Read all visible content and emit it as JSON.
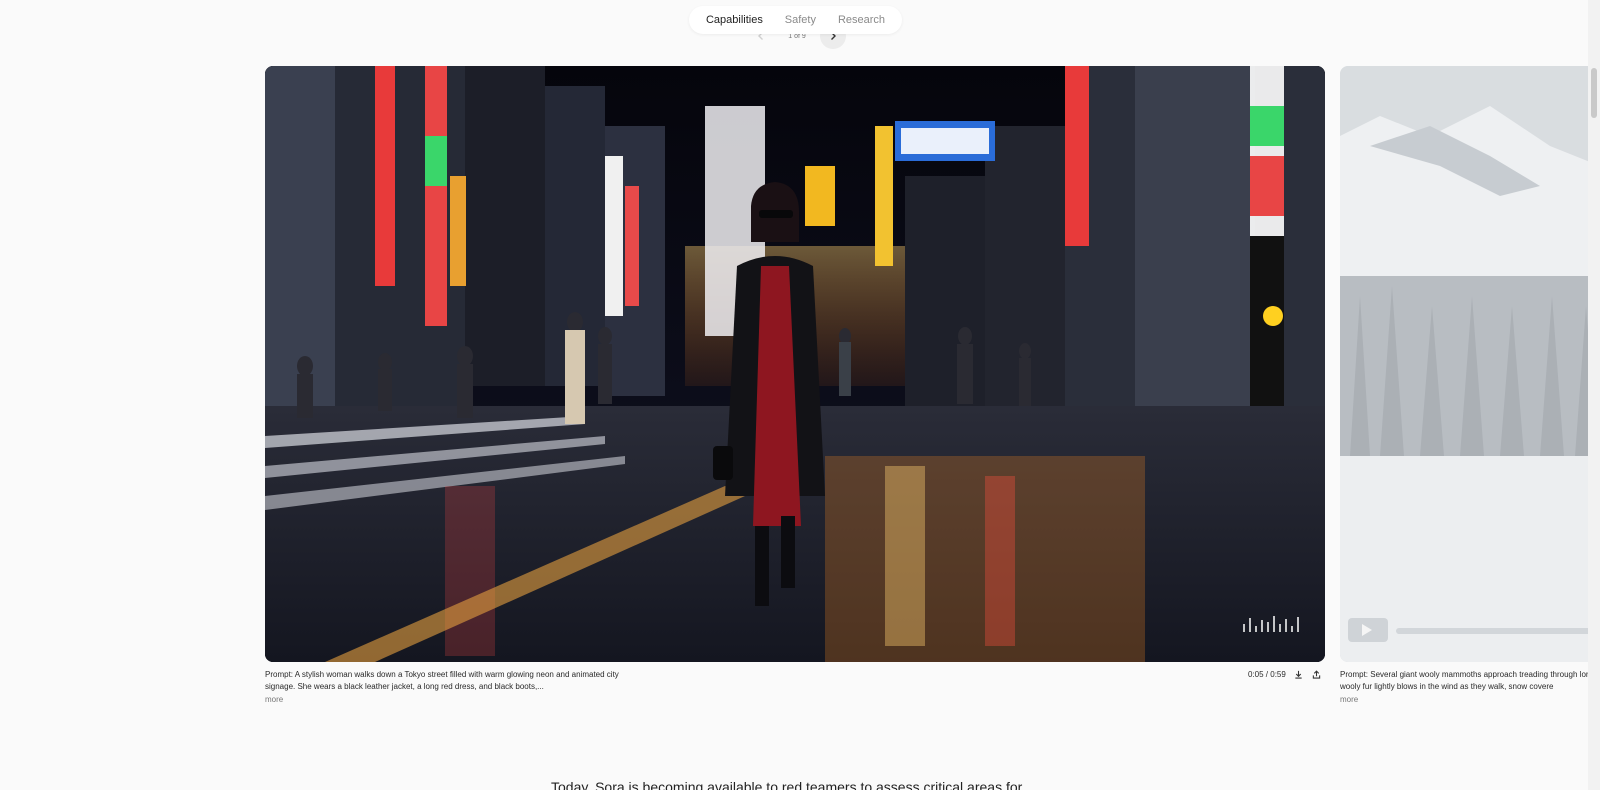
{
  "nav": {
    "tabs": [
      {
        "label": "Capabilities",
        "active": true
      },
      {
        "label": "Safety",
        "active": false
      },
      {
        "label": "Research",
        "active": false
      }
    ]
  },
  "pager": {
    "count": "1 of 9",
    "prev_icon": "chevron-left-icon",
    "next_icon": "chevron-right-icon"
  },
  "video1": {
    "prompt": "Prompt: A stylish woman walks down a Tokyo street filled with warm glowing neon and animated city signage. She wears a black leather jacket, a long red dress, and black boots,...",
    "more": "more",
    "time": "0:05 / 0:59",
    "download_icon": "download-icon",
    "share_icon": "share-icon",
    "progress_fraction": 0.085
  },
  "video2": {
    "prompt": "Prompt: Several giant wooly mammoths approach treading through long wooly fur lightly blows in the wind as they walk, snow covere",
    "more": "more"
  },
  "body": {
    "text": "Today, Sora is becoming available to red teamers to assess critical areas for"
  },
  "colors": {
    "background": "#fafafa",
    "accent": "#222222"
  }
}
